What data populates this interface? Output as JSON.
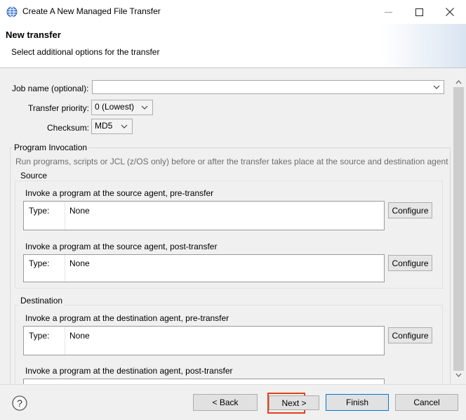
{
  "window": {
    "title": "Create A New Managed File Transfer",
    "minimize_icon": "minimize-icon",
    "maximize_icon": "maximize-icon",
    "close_icon": "close-icon"
  },
  "banner": {
    "title": "New transfer",
    "subtitle": "Select additional options for the transfer"
  },
  "form": {
    "job_name_label": "Job name (optional):",
    "job_name_value": "",
    "priority_label": "Transfer priority:",
    "priority_value": "0 (Lowest)",
    "checksum_label": "Checksum:",
    "checksum_value": "MD5"
  },
  "program_invocation": {
    "legend": "Program Invocation",
    "description": "Run programs, scripts or JCL (z/OS only) before or after the transfer takes place at the source and destination agent",
    "source": {
      "legend": "Source",
      "pre_label": "Invoke a program at the source agent, pre-transfer",
      "pre_type_label": "Type:",
      "pre_type_value": "None",
      "post_label": "Invoke a program at the source agent, post-transfer",
      "post_type_label": "Type:",
      "post_type_value": "None"
    },
    "destination": {
      "legend": "Destination",
      "pre_label": "Invoke a program at the destination agent, pre-transfer",
      "pre_type_label": "Type:",
      "pre_type_value": "None",
      "post_label": "Invoke a program at the destination agent, post-transfer"
    },
    "configure_label": "Configure"
  },
  "footer": {
    "help_icon": "help-icon",
    "back_label": "< Back",
    "next_label": "Next >",
    "finish_label": "Finish",
    "cancel_label": "Cancel",
    "highlight_color": "#e2401c"
  },
  "colors": {
    "default_button_border": "#0078d7"
  }
}
